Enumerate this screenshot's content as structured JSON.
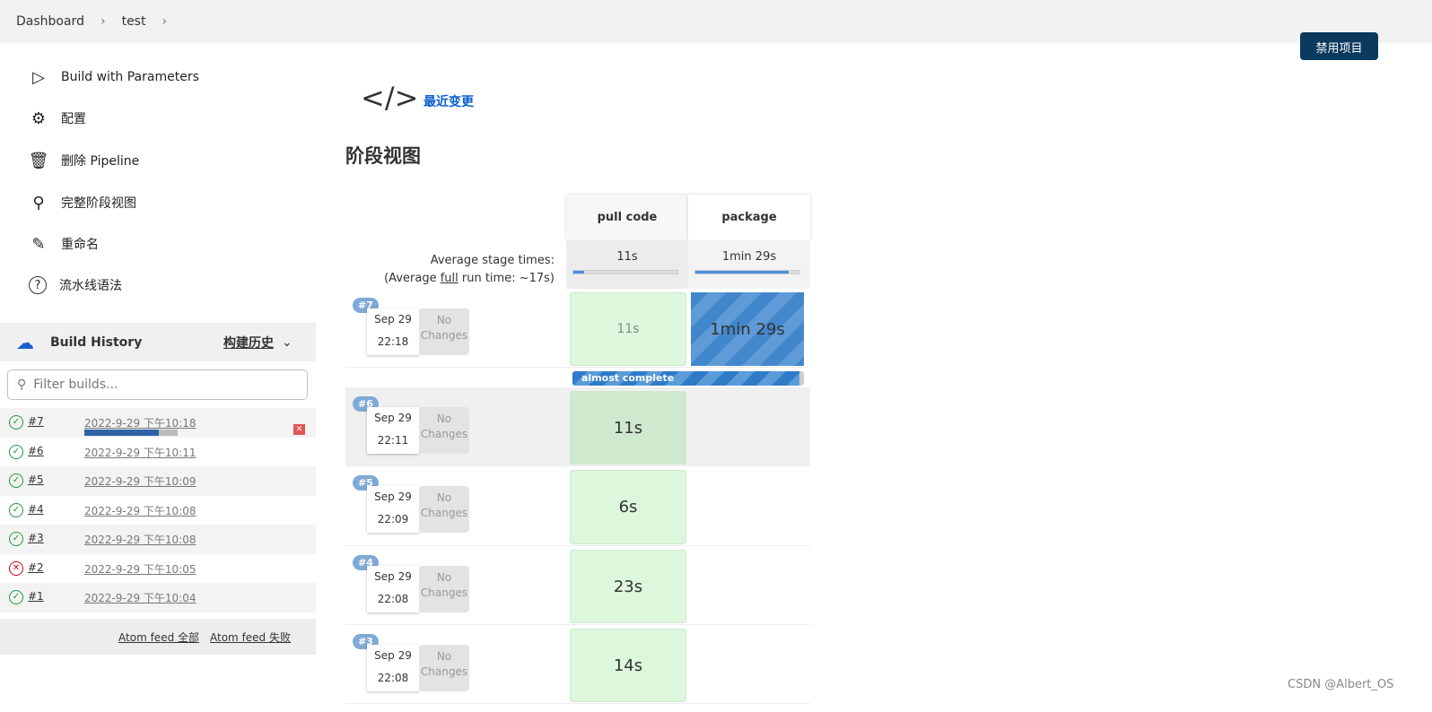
{
  "breadcrumb": [
    "Dashboard",
    "test"
  ],
  "disable_button": "禁用项目",
  "sidebar": {
    "items": [
      {
        "label": "Build with Parameters",
        "icon": "play-icon"
      },
      {
        "label": "配置",
        "icon": "gear-icon"
      },
      {
        "label": "删除 Pipeline",
        "icon": "trash-icon"
      },
      {
        "label": "完整阶段视图",
        "icon": "search-icon"
      },
      {
        "label": "重命名",
        "icon": "pencil-icon"
      },
      {
        "label": "流水线语法",
        "icon": "help-icon"
      }
    ]
  },
  "build_history": {
    "title": "Build History",
    "trend_link": "构建历史",
    "filter_placeholder": "Filter builds...",
    "builds": [
      {
        "num": "#7",
        "date": "2022-9-29 下午10:18",
        "status": "running",
        "progress": 0.8
      },
      {
        "num": "#6",
        "date": "2022-9-29 下午10:11",
        "status": "success"
      },
      {
        "num": "#5",
        "date": "2022-9-29 下午10:09",
        "status": "success"
      },
      {
        "num": "#4",
        "date": "2022-9-29 下午10:08",
        "status": "success"
      },
      {
        "num": "#3",
        "date": "2022-9-29 下午10:08",
        "status": "success"
      },
      {
        "num": "#2",
        "date": "2022-9-29 下午10:05",
        "status": "failed"
      },
      {
        "num": "#1",
        "date": "2022-9-29 下午10:04",
        "status": "success"
      }
    ],
    "feeds": [
      "Atom feed 全部",
      "Atom feed 失败"
    ]
  },
  "recent_changes": "最近变更",
  "stage_view": {
    "title": "阶段视图",
    "stages": [
      "pull code",
      "package"
    ],
    "avg_label": "Average stage times:",
    "avg_full_prefix": "(Average ",
    "avg_full_word": "full",
    "avg_full_suffix": " run time: ~17s)",
    "avg_times": [
      "11s",
      "1min 29s"
    ],
    "avg_progress": [
      0.1,
      0.9
    ],
    "no_changes": [
      "No",
      "Changes"
    ],
    "rows": [
      {
        "badge": "#7",
        "date": "Sep 29",
        "time": "22:18",
        "cells": [
          "11s",
          "1min 29s"
        ],
        "status_text": "almost complete"
      },
      {
        "badge": "#6",
        "date": "Sep 29",
        "time": "22:11",
        "cells": [
          "11s",
          ""
        ]
      },
      {
        "badge": "#5",
        "date": "Sep 29",
        "time": "22:09",
        "cells": [
          "6s",
          ""
        ]
      },
      {
        "badge": "#4",
        "date": "Sep 29",
        "time": "22:08",
        "cells": [
          "23s",
          ""
        ]
      },
      {
        "badge": "#3",
        "date": "Sep 29",
        "time": "22:08",
        "cells": [
          "14s",
          ""
        ]
      }
    ]
  },
  "watermark": "CSDN @Albert_OS"
}
